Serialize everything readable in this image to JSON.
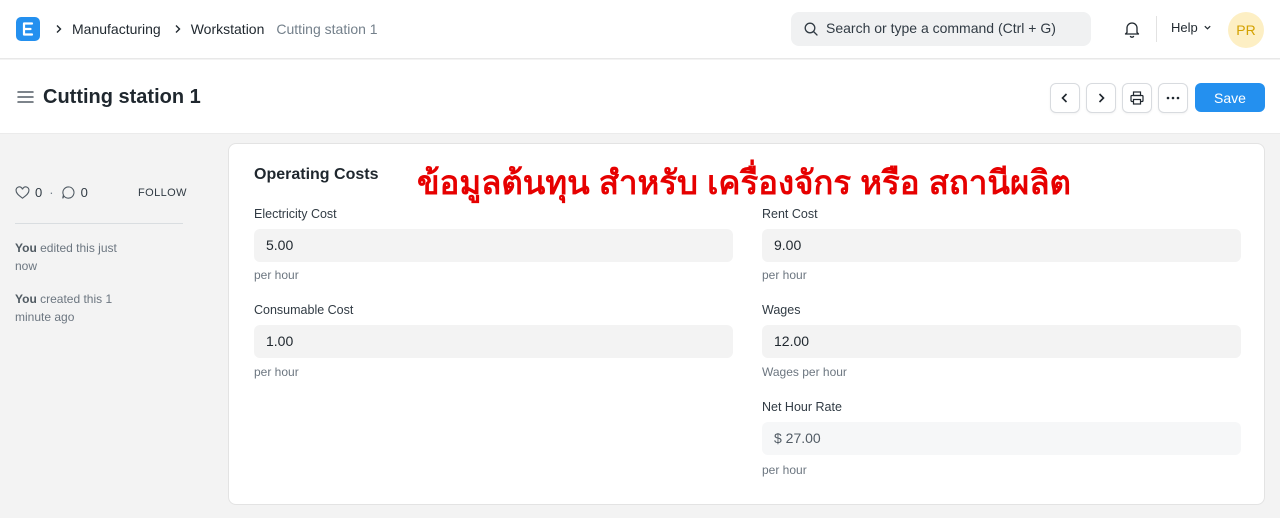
{
  "navbar": {
    "breadcrumbs": [
      "Manufacturing",
      "Workstation",
      "Cutting station 1"
    ],
    "search_placeholder": "Search or type a command (Ctrl + G)",
    "help_label": "Help",
    "avatar_initials": "PR"
  },
  "page": {
    "title": "Cutting station 1",
    "save_label": "Save"
  },
  "sidebar": {
    "likes": "0",
    "comments": "0",
    "follow_label": "FOLLOW",
    "activity": [
      {
        "who": "You",
        "action": " edited this just now"
      },
      {
        "who": "You",
        "action": " created this 1 minute ago"
      }
    ]
  },
  "form": {
    "section_title": "Operating Costs",
    "overlay_text": "ข้อมูลต้นทุน สำหรับ เครื่องจักร หรือ สถานีผลิต",
    "electricity": {
      "label": "Electricity Cost",
      "value": "5.00",
      "desc": "per hour"
    },
    "consumable": {
      "label": "Consumable Cost",
      "value": "1.00",
      "desc": "per hour"
    },
    "rent": {
      "label": "Rent Cost",
      "value": "9.00",
      "desc": "per hour"
    },
    "wages": {
      "label": "Wages",
      "value": "12.00",
      "desc": "Wages per hour"
    },
    "net_hour_rate": {
      "label": "Net Hour Rate",
      "value": "$ 27.00",
      "desc": "per hour"
    }
  },
  "colors": {
    "primary": "#2490ef",
    "overlay_text": "#e60000",
    "avatar_bg": "#fdefc4",
    "avatar_text": "#d3a100"
  }
}
